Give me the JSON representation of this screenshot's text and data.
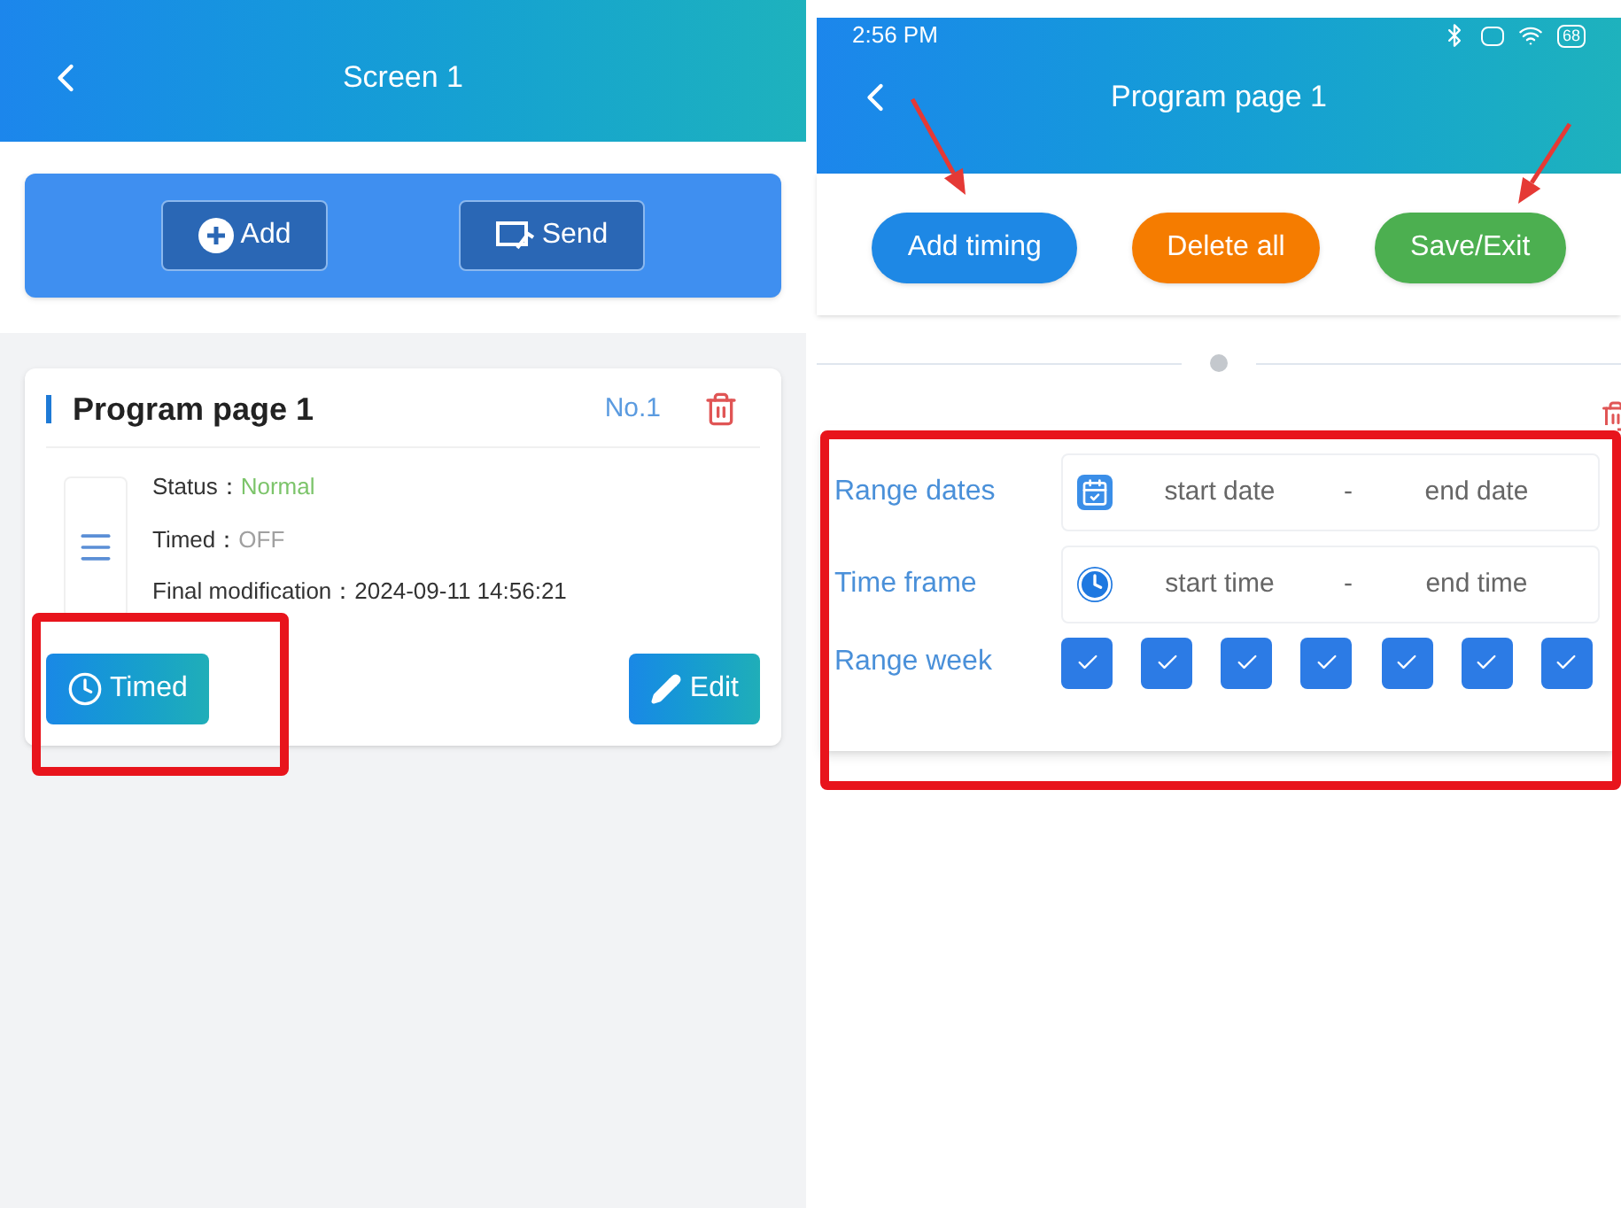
{
  "left_screen": {
    "title": "Screen 1",
    "toolbar": [
      {
        "kind": "add",
        "label": "Add"
      },
      {
        "kind": "send",
        "label": "Send"
      }
    ],
    "program_card": {
      "title": "Program page 1",
      "number": "No.1",
      "fields": [
        {
          "label": "Status：",
          "value": "Normal",
          "color": "#7cc46a"
        },
        {
          "label": "Timed：",
          "value": "OFF",
          "color": "#a0a0a0"
        },
        {
          "label": "Final modification：",
          "value": "2024-09-11 14:56:21",
          "color": "#333333"
        }
      ],
      "buttons": [
        {
          "kind": "timed",
          "label": "Timed"
        },
        {
          "kind": "edit",
          "label": "Edit"
        }
      ]
    }
  },
  "right_screen": {
    "status_bar": {
      "time": "2:56 PM",
      "battery": "68"
    },
    "title": "Program page 1",
    "actions": [
      {
        "label": "Add timing",
        "color": "#1e88e5"
      },
      {
        "label": "Delete all",
        "color": "#f57c00"
      },
      {
        "label": "Save/Exit",
        "color": "#4caf50"
      }
    ],
    "form": {
      "range_dates": {
        "label": "Range dates",
        "start": "start date",
        "separator": "-",
        "end": "end date"
      },
      "time_frame": {
        "label": "Time frame",
        "start": "start time",
        "separator": "-",
        "end": "end time"
      },
      "range_week": {
        "label": "Range week",
        "days": [
          {
            "checked": true
          },
          {
            "checked": true
          },
          {
            "checked": true
          },
          {
            "checked": true
          },
          {
            "checked": true
          },
          {
            "checked": true
          },
          {
            "checked": true
          }
        ]
      }
    }
  }
}
